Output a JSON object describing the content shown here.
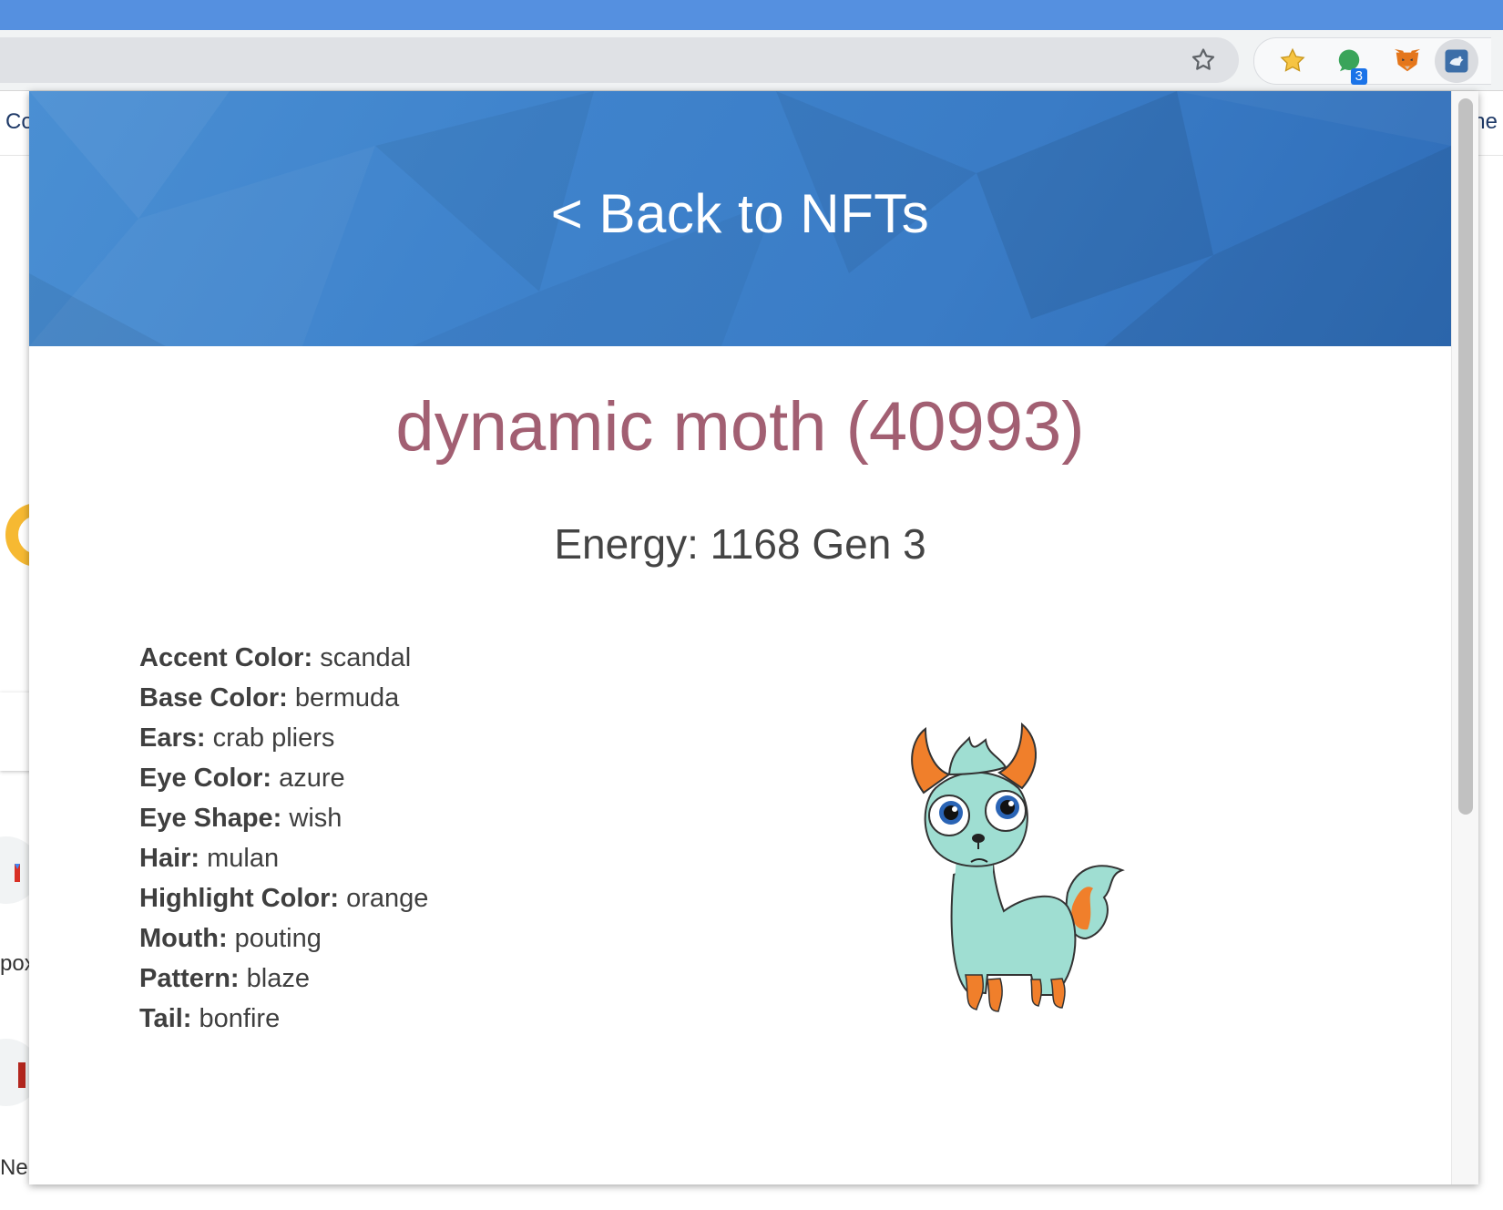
{
  "browser": {
    "extensions": [
      {
        "name": "bookmark-star-extension"
      },
      {
        "name": "chat-extension",
        "badge": "3"
      },
      {
        "name": "metamask-fox-extension"
      },
      {
        "name": "cryptokitties-extension"
      }
    ],
    "bookmarks": {
      "left_fragment": "Co",
      "right_fragment": "the"
    }
  },
  "background_page": {
    "frag1": "pox",
    "frag2": "Ne"
  },
  "popup": {
    "back_link": "< Back to NFTs",
    "title": "dynamic moth (40993)",
    "subtitle": "Energy: 1168 Gen 3",
    "attributes": [
      {
        "key": "Accent Color:",
        "value": " scandal"
      },
      {
        "key": "Base Color:",
        "value": " bermuda"
      },
      {
        "key": "Ears:",
        "value": " crab pliers"
      },
      {
        "key": "Eye Color:",
        "value": " azure"
      },
      {
        "key": "Eye Shape:",
        "value": " wish"
      },
      {
        "key": "Hair:",
        "value": " mulan"
      },
      {
        "key": "Highlight Color:",
        "value": " orange"
      },
      {
        "key": "Mouth:",
        "value": " pouting"
      },
      {
        "key": "Pattern:",
        "value": " blaze"
      },
      {
        "key": "Tail:",
        "value": " bonfire"
      }
    ]
  },
  "colors": {
    "chrome_top": "#5590e0",
    "banner": "#3f83cc",
    "title": "#a25f72",
    "kitty_body": "#9fded2",
    "kitty_accent": "#f07f2b"
  }
}
